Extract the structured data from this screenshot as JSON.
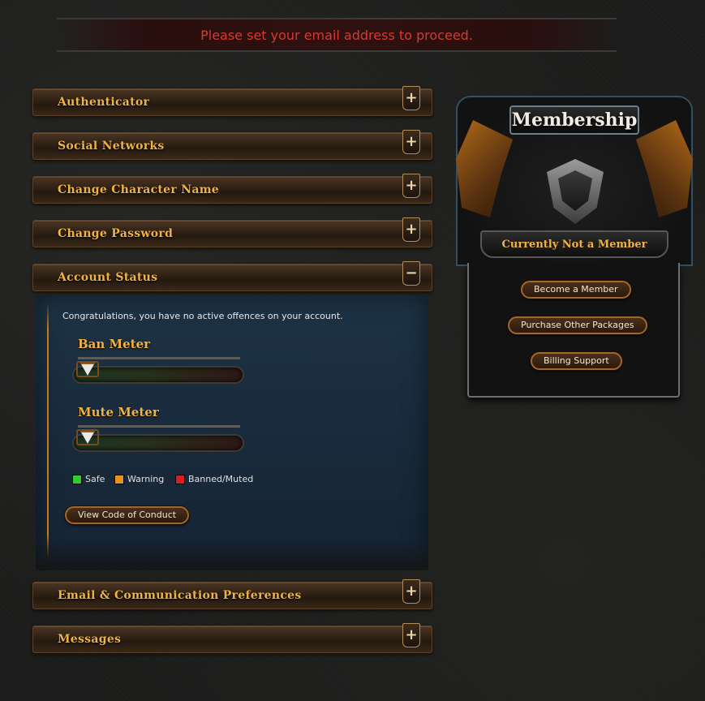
{
  "notice": "Please set your email address to proceed.",
  "sections": [
    {
      "label": "Authenticator",
      "toggle": "+"
    },
    {
      "label": "Social Networks",
      "toggle": "+"
    },
    {
      "label": "Change Character Name",
      "toggle": "+"
    },
    {
      "label": "Change Password",
      "toggle": "+"
    },
    {
      "label": "Account Status",
      "toggle": "−"
    },
    {
      "label": "Email & Communication Preferences",
      "toggle": "+"
    },
    {
      "label": "Messages",
      "toggle": "+"
    }
  ],
  "account_status": {
    "message": "Congratulations, you have no active offences on your account.",
    "ban_meter": {
      "title": "Ban Meter",
      "level": 0
    },
    "mute_meter": {
      "title": "Mute Meter",
      "level": 0
    },
    "legend": [
      {
        "label": "Safe",
        "color": "#2ecc2e"
      },
      {
        "label": "Warning",
        "color": "#e8921e"
      },
      {
        "label": "Banned/Muted",
        "color": "#d42020"
      }
    ],
    "conduct_button": "View Code of Conduct"
  },
  "membership": {
    "title": "Membership",
    "status": "Currently Not a Member",
    "buttons": [
      "Become a Member",
      "Purchase Other Packages",
      "Billing Support"
    ]
  }
}
